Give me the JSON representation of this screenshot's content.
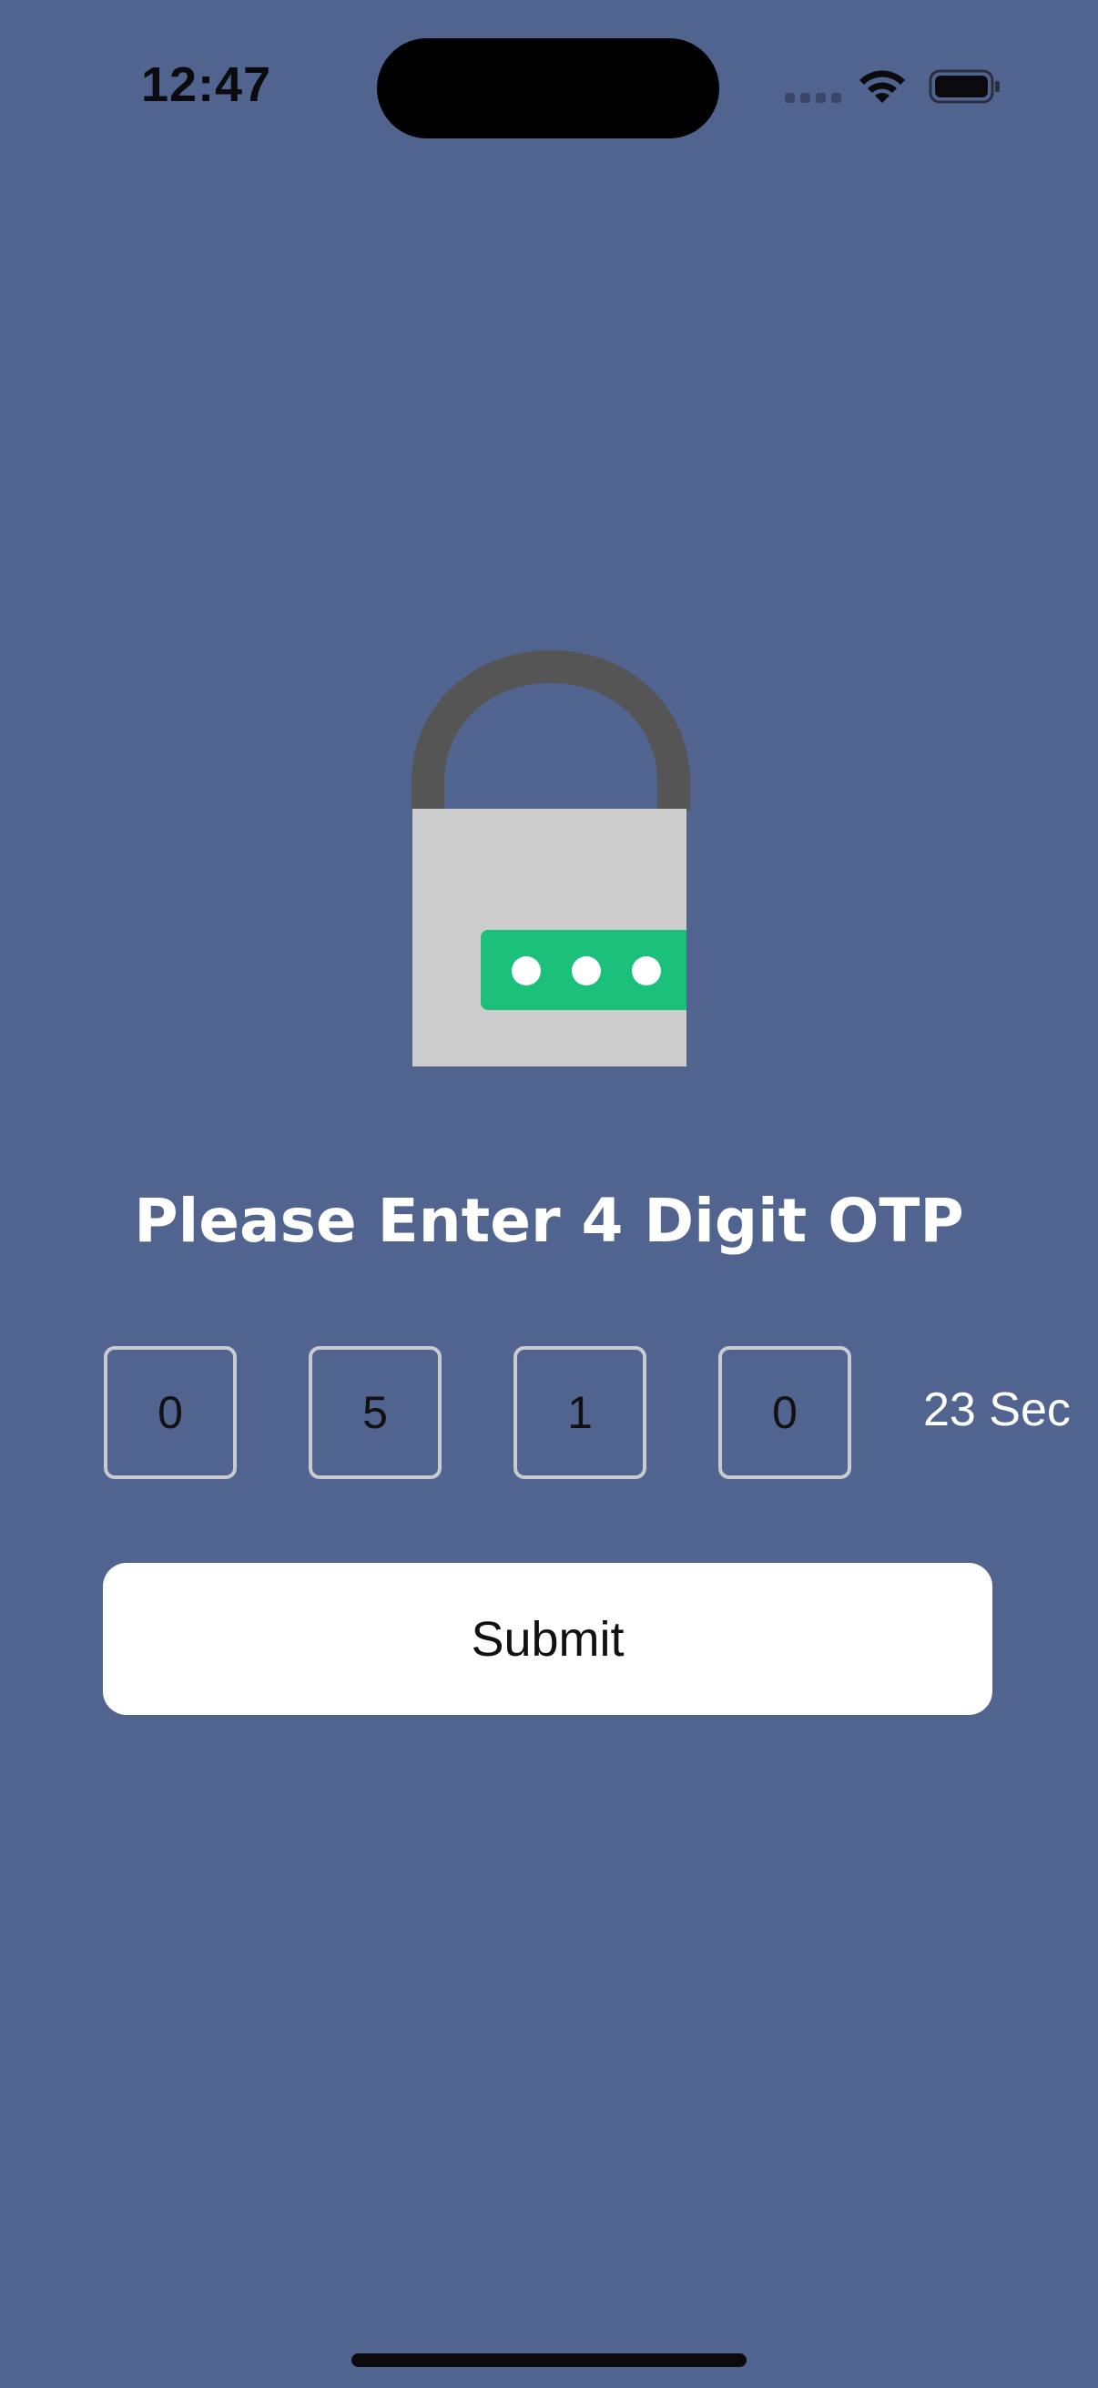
{
  "status_bar": {
    "time": "12:47",
    "icons": [
      "cellular-signal-icon",
      "wifi-icon",
      "battery-icon"
    ]
  },
  "illustration": {
    "icon": "padlock-password-icon",
    "colors": {
      "shackle": "#555555",
      "body": "#cccccc",
      "password_field": "#1bc07a",
      "dots": "#ffffff"
    }
  },
  "otp": {
    "title": "Please Enter 4 Digit OTP",
    "digits": [
      "0",
      "5",
      "1",
      "0"
    ],
    "timer": "23 Sec"
  },
  "actions": {
    "submit_label": "Submit"
  },
  "theme": {
    "background": "#51648f",
    "button_bg": "#ffffff",
    "box_border": "#c9cbd3"
  }
}
